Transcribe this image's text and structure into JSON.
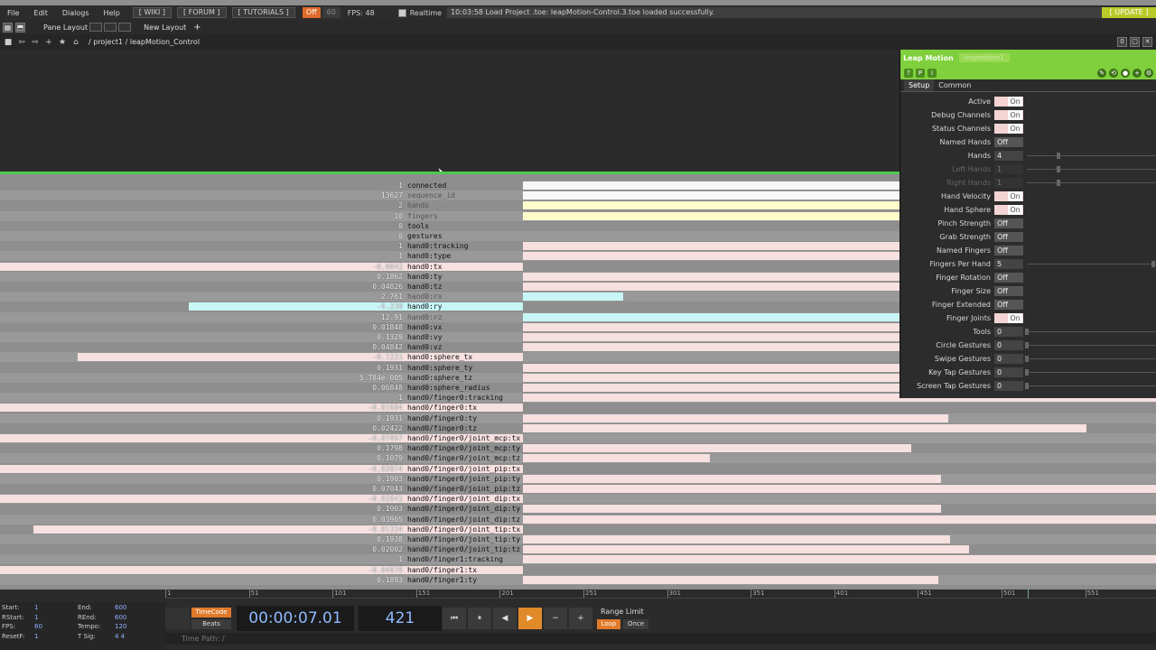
{
  "menu": {
    "items": [
      "File",
      "Edit",
      "Dialogs",
      "Help"
    ],
    "buttons": [
      "[ WIKI ]",
      "[ FORUM ]",
      "[ TUTORIALS ]"
    ],
    "perform_label": "Off",
    "fps_cap": "60",
    "fps_text": "FPS:   48",
    "realtime_label": "Realtime",
    "log": "10:03:58 Load Project .toe: leapMotion-Control.3.toe loaded successfully.",
    "update_label": "[ UPDATE ]"
  },
  "layout_bar": {
    "pane_layout": "Pane Layout",
    "new_layout": "New Layout",
    "plus": "+"
  },
  "path_bar": {
    "path": "/  project1  /  leapMotion_Control",
    "mini": [
      "0",
      "□",
      "✕"
    ]
  },
  "channels": [
    {
      "value": "1",
      "name": "connected",
      "bar_color": "#f7f7f7",
      "bar_from": 0.452,
      "bar_to": 1.0,
      "text_color": "#111"
    },
    {
      "value": "13627",
      "name": "sequence_id",
      "bar_color": "#f7f7f7",
      "bar_from": 0.452,
      "bar_to": 0.878,
      "text_color": "#555"
    },
    {
      "value": "2",
      "name": "hands",
      "bar_color": "#fffccc",
      "bar_from": 0.452,
      "bar_to": 1.0,
      "text_color": "#555"
    },
    {
      "value": "10",
      "name": "fingers",
      "bar_color": "#fffccc",
      "bar_from": 0.452,
      "bar_to": 1.0,
      "text_color": "#555"
    },
    {
      "value": "0",
      "name": "tools",
      "bar_color": "",
      "bar_from": 0,
      "bar_to": 0,
      "text_color": "#111"
    },
    {
      "value": "0",
      "name": "gestures",
      "bar_color": "",
      "bar_from": 0,
      "bar_to": 0,
      "text_color": "#111"
    },
    {
      "value": "1",
      "name": "hand0:tracking",
      "bar_color": "#f6e0e0",
      "bar_from": 0.452,
      "bar_to": 1.0,
      "text_color": "#111"
    },
    {
      "value": "1",
      "name": "hand0:type",
      "bar_color": "#f6e0e0",
      "bar_from": 0.452,
      "bar_to": 1.0,
      "text_color": "#111"
    },
    {
      "value": "-0.0842",
      "name": "hand0:tx",
      "bar_color": "#f6e0e0",
      "bar_from": 0.0,
      "bar_to": 0.452,
      "text_color": "#111"
    },
    {
      "value": "0.1862",
      "name": "hand0:ty",
      "bar_color": "#f6e0e0",
      "bar_from": 0.452,
      "bar_to": 1.0,
      "text_color": "#111"
    },
    {
      "value": "0.04826",
      "name": "hand0:tz",
      "bar_color": "#f6e0e0",
      "bar_from": 0.452,
      "bar_to": 1.0,
      "text_color": "#111"
    },
    {
      "value": "2.761",
      "name": "hand0:rx",
      "bar_color": "#c8f6f6",
      "bar_from": 0.452,
      "bar_to": 0.539,
      "text_color": "#555"
    },
    {
      "value": "-9.238",
      "name": "hand0:ry",
      "bar_color": "#c8f6f6",
      "bar_from": 0.163,
      "bar_to": 0.452,
      "text_color": "#111"
    },
    {
      "value": "12.91",
      "name": "hand0:rz",
      "bar_color": "#c8f6f6",
      "bar_from": 0.452,
      "bar_to": 0.856,
      "text_color": "#555"
    },
    {
      "value": "0.01848",
      "name": "hand0:vx",
      "bar_color": "#f6e0e0",
      "bar_from": 0.452,
      "bar_to": 1.0,
      "text_color": "#111"
    },
    {
      "value": "0.1329",
      "name": "hand0:vy",
      "bar_color": "#f6e0e0",
      "bar_from": 0.452,
      "bar_to": 0.867,
      "text_color": "#111"
    },
    {
      "value": "0.04842",
      "name": "hand0:vz",
      "bar_color": "#f6e0e0",
      "bar_from": 0.452,
      "bar_to": 1.0,
      "text_color": "#111"
    },
    {
      "value": "-0.1231",
      "name": "hand0:sphere_tx",
      "bar_color": "#f6e0e0",
      "bar_from": 0.067,
      "bar_to": 0.452,
      "text_color": "#111"
    },
    {
      "value": "0.1931",
      "name": "hand0:sphere_ty",
      "bar_color": "#f6e0e0",
      "bar_from": 0.452,
      "bar_to": 1.0,
      "text_color": "#111"
    },
    {
      "value": "5.784e-005",
      "name": "hand0:sphere_tz",
      "bar_color": "#f6e0e0",
      "bar_from": 0.452,
      "bar_to": 1.0,
      "text_color": "#111"
    },
    {
      "value": "0.06848",
      "name": "hand0:sphere_radius",
      "bar_color": "#f6e0e0",
      "bar_from": 0.452,
      "bar_to": 1.0,
      "text_color": "#111"
    },
    {
      "value": "1",
      "name": "hand0/finger0:tracking",
      "bar_color": "#f6e0e0",
      "bar_from": 0.452,
      "bar_to": 1.0,
      "text_color": "#111"
    },
    {
      "value": "-0.01684",
      "name": "hand0/finger0:tx",
      "bar_color": "#f6e0e0",
      "bar_from": 0.0,
      "bar_to": 0.452,
      "text_color": "#111"
    },
    {
      "value": "0.1931",
      "name": "hand0/finger0:ty",
      "bar_color": "#f6e0e0",
      "bar_from": 0.452,
      "bar_to": 0.82,
      "text_color": "#111"
    },
    {
      "value": "0.02422",
      "name": "hand0/finger0:tz",
      "bar_color": "#f6e0e0",
      "bar_from": 0.452,
      "bar_to": 0.94,
      "text_color": "#111"
    },
    {
      "value": "-0.07097",
      "name": "hand0/finger0/joint_mcp:tx",
      "bar_color": "#f6e0e0",
      "bar_from": 0.0,
      "bar_to": 0.452,
      "text_color": "#111"
    },
    {
      "value": "0.1798",
      "name": "hand0/finger0/joint_mcp:ty",
      "bar_color": "#f6e0e0",
      "bar_from": 0.452,
      "bar_to": 0.788,
      "text_color": "#111"
    },
    {
      "value": "0.1079",
      "name": "hand0/finger0/joint_mcp:tz",
      "bar_color": "#f6e0e0",
      "bar_from": 0.452,
      "bar_to": 0.614,
      "text_color": "#111"
    },
    {
      "value": "-0.03974",
      "name": "hand0/finger0/joint_pip:tx",
      "bar_color": "#f6e0e0",
      "bar_from": 0.0,
      "bar_to": 0.452,
      "text_color": "#111"
    },
    {
      "value": "0.1903",
      "name": "hand0/finger0/joint_pip:ty",
      "bar_color": "#f6e0e0",
      "bar_from": 0.452,
      "bar_to": 0.814,
      "text_color": "#111"
    },
    {
      "value": "0.07043",
      "name": "hand0/finger0/joint_pip:tz",
      "bar_color": "#f6e0e0",
      "bar_from": 0.452,
      "bar_to": 1.0,
      "text_color": "#111"
    },
    {
      "value": "-0.02641",
      "name": "hand0/finger0/joint_dip:tx",
      "bar_color": "#f6e0e0",
      "bar_from": 0.0,
      "bar_to": 0.452,
      "text_color": "#111"
    },
    {
      "value": "0.1903",
      "name": "hand0/finger0/joint_dip:ty",
      "bar_color": "#f6e0e0",
      "bar_from": 0.452,
      "bar_to": 0.814,
      "text_color": "#111"
    },
    {
      "value": "0.03905",
      "name": "hand0/finger0/joint_dip:tz",
      "bar_color": "#f6e0e0",
      "bar_from": 0.452,
      "bar_to": 1.0,
      "text_color": "#111"
    },
    {
      "value": "-0.01324",
      "name": "hand0/finger0/joint_tip:tx",
      "bar_color": "#f6e0e0",
      "bar_from": 0.029,
      "bar_to": 0.452,
      "text_color": "#111"
    },
    {
      "value": "0.1938",
      "name": "hand0/finger0/joint_tip:ty",
      "bar_color": "#f6e0e0",
      "bar_from": 0.452,
      "bar_to": 0.822,
      "text_color": "#111"
    },
    {
      "value": "0.02002",
      "name": "hand0/finger0/joint_tip:tz",
      "bar_color": "#f6e0e0",
      "bar_from": 0.452,
      "bar_to": 0.838,
      "text_color": "#111"
    },
    {
      "value": "1",
      "name": "hand0/finger1:tracking",
      "bar_color": "#f6e0e0",
      "bar_from": 0.452,
      "bar_to": 1.0,
      "text_color": "#111"
    },
    {
      "value": "-0.04076",
      "name": "hand0/finger1:tx",
      "bar_color": "#f6e0e0",
      "bar_from": 0.0,
      "bar_to": 0.452,
      "text_color": "#111"
    },
    {
      "value": "0.1893",
      "name": "hand0/finger1:ty",
      "bar_color": "#f6e0e0",
      "bar_from": 0.452,
      "bar_to": 0.812,
      "text_color": "#111"
    }
  ],
  "panel": {
    "title": "Leap Motion",
    "subtitle": "leapmotion1",
    "tabs": [
      "Setup",
      "Common"
    ],
    "params": [
      {
        "label": "Active",
        "type": "toggle",
        "value": "On",
        "on": true
      },
      {
        "label": "Debug Channels",
        "type": "toggle",
        "value": "On",
        "on": true
      },
      {
        "label": "Status Channels",
        "type": "toggle",
        "value": "On",
        "on": true
      },
      {
        "label": "Named Hands",
        "type": "toggle",
        "value": "Off",
        "on": false
      },
      {
        "label": "Hands",
        "type": "number",
        "value": "4",
        "slider": true,
        "knob": 0.25
      },
      {
        "label": "Left Hands",
        "type": "number",
        "value": "1",
        "slider": true,
        "knob": 0.25,
        "disabled": true
      },
      {
        "label": "Right Hands",
        "type": "number",
        "value": "1",
        "slider": true,
        "knob": 0.25,
        "disabled": true
      },
      {
        "label": "Hand Velocity",
        "type": "toggle",
        "value": "On",
        "on": true
      },
      {
        "label": "Hand Sphere",
        "type": "toggle",
        "value": "On",
        "on": true
      },
      {
        "label": "Pinch Strength",
        "type": "toggle",
        "value": "Off",
        "on": false
      },
      {
        "label": "Grab Strength",
        "type": "toggle",
        "value": "Off",
        "on": false
      },
      {
        "label": "Named Fingers",
        "type": "toggle",
        "value": "Off",
        "on": false
      },
      {
        "label": "Fingers Per Hand",
        "type": "number",
        "value": "5",
        "slider": true,
        "knob": 1.0
      },
      {
        "label": "Finger Rotation",
        "type": "toggle",
        "value": "Off",
        "on": false
      },
      {
        "label": "Finger Size",
        "type": "toggle",
        "value": "Off",
        "on": false
      },
      {
        "label": "Finger Extended",
        "type": "toggle",
        "value": "Off",
        "on": false
      },
      {
        "label": "Finger Joints",
        "type": "toggle",
        "value": "On",
        "on": true
      },
      {
        "label": "Tools",
        "type": "number",
        "value": "0",
        "slider": true,
        "knob": 0.0
      },
      {
        "label": "Circle Gestures",
        "type": "number",
        "value": "0",
        "slider": true,
        "knob": 0.0
      },
      {
        "label": "Swipe Gestures",
        "type": "number",
        "value": "0",
        "slider": true,
        "knob": 0.0
      },
      {
        "label": "Key Tap Gestures",
        "type": "number",
        "value": "0",
        "slider": true,
        "knob": 0.0
      },
      {
        "label": "Screen Tap Gestures",
        "type": "number",
        "value": "0",
        "slider": true,
        "knob": 0.0
      }
    ]
  },
  "timeline": {
    "ticks": [
      "1",
      "51",
      "101",
      "151",
      "201",
      "251",
      "301",
      "351",
      "401",
      "451",
      "501",
      "551",
      "60"
    ],
    "stats": [
      {
        "k": "Start:",
        "v": "1"
      },
      {
        "k": "End:",
        "v": "600"
      },
      {
        "k": "RStart:",
        "v": "1"
      },
      {
        "k": "REnd:",
        "v": "600"
      },
      {
        "k": "FPS:",
        "v": "60"
      },
      {
        "k": "Tempo:",
        "v": "120"
      },
      {
        "k": "ResetF:",
        "v": "1"
      },
      {
        "k": "T Sig:",
        "v": "4    4"
      }
    ],
    "timecode_btn": "TimeCode",
    "beats_btn": "Beats",
    "timecode": "00:00:07.01",
    "frame": "421",
    "range_limit": "Range Limit",
    "loop": "Loop",
    "once": "Once",
    "time_path": "Time Path: /",
    "transport": [
      "⏮",
      "⏸",
      "◀",
      "▶",
      "−",
      "+"
    ]
  }
}
